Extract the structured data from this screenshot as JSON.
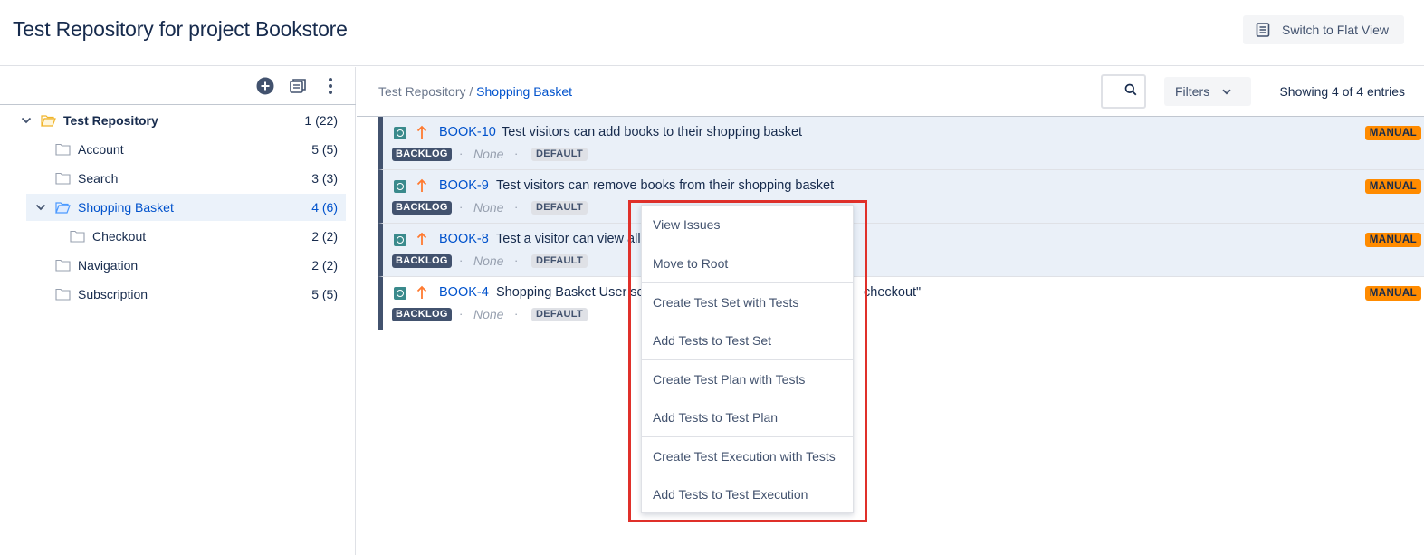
{
  "header": {
    "title": "Test Repository for project Bookstore",
    "switch_button": "Switch to Flat View"
  },
  "tree": {
    "toolbar_icons": [
      "add-folder-icon",
      "collapse-all-icon",
      "more-vertical-icon"
    ],
    "items": [
      {
        "label": "Test Repository",
        "count": "1 (22)"
      },
      {
        "label": "Account",
        "count": "5 (5)"
      },
      {
        "label": "Search",
        "count": "3 (3)"
      },
      {
        "label": "Shopping Basket",
        "count": "4 (6)"
      },
      {
        "label": "Checkout",
        "count": "2 (2)"
      },
      {
        "label": "Navigation",
        "count": "2 (2)"
      },
      {
        "label": "Subscription",
        "count": "5 (5)"
      }
    ]
  },
  "main": {
    "breadcrumb": {
      "root": "Test Repository",
      "separator": "/",
      "current": "Shopping Basket"
    },
    "filters_label": "Filters",
    "showing": "Showing 4 of 4 entries",
    "issues": [
      {
        "key": "BOOK-10",
        "summary": "Test visitors can add books to their shopping basket",
        "status": "BACKLOG",
        "none": "None",
        "dataset": "DEFAULT",
        "test_type": "MANUAL"
      },
      {
        "key": "BOOK-9",
        "summary": "Test visitors can remove books from their shopping basket",
        "status": "BACKLOG",
        "none": "None",
        "dataset": "DEFAULT",
        "test_type": "MANUAL"
      },
      {
        "key": "BOOK-8",
        "summary": "Test a visitor can view all",
        "status": "BACKLOG",
        "none": "None",
        "dataset": "DEFAULT",
        "test_type": "MANUAL"
      },
      {
        "key": "BOOK-4",
        "summary": "Shopping Basket User se",
        "summary_tail": "checkout\"",
        "status": "BACKLOG",
        "none": "None",
        "dataset": "DEFAULT",
        "test_type": "MANUAL"
      }
    ]
  },
  "context_menu": {
    "items": [
      "View Issues",
      "Move to Root",
      "Create Test Set with Tests",
      "Add Tests to Test Set",
      "Create Test Plan with Tests",
      "Add Tests to Test Plan",
      "Create Test Execution with Tests",
      "Add Tests to Test Execution"
    ]
  },
  "colors": {
    "link": "#0052cc",
    "manual_badge": "#ff8b00",
    "backlog_badge": "#42526e",
    "highlight_border": "#e0302a",
    "selected_row": "#ebf2fa"
  }
}
